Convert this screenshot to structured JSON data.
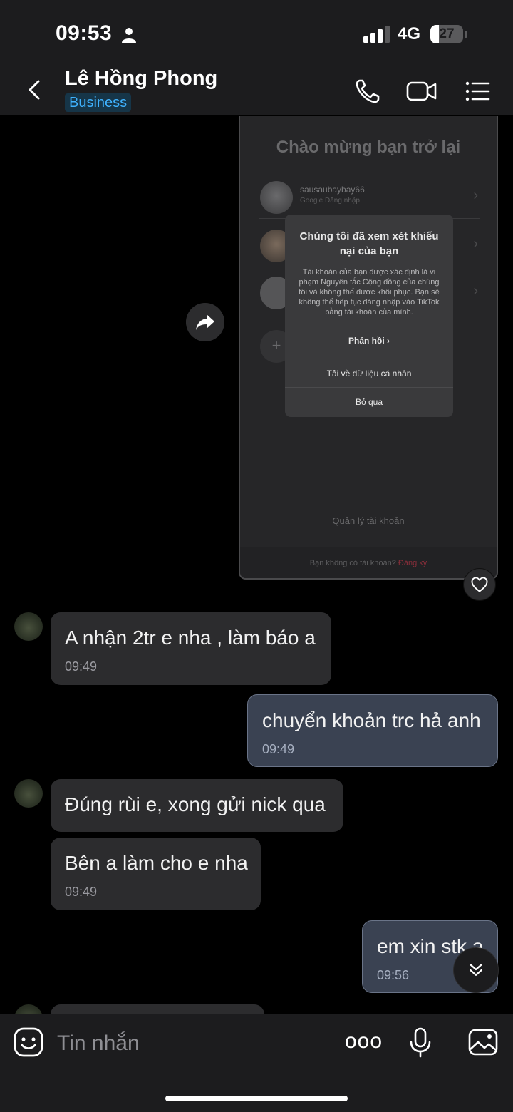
{
  "status_bar": {
    "time": "09:53",
    "network": "4G",
    "battery_level": "27"
  },
  "header": {
    "name": "Lê Hồng Phong",
    "badge": "Business"
  },
  "shared_screenshot": {
    "title": "Chào mừng bạn trở lại",
    "accounts": [
      {
        "name": "sausaubaybay66",
        "sub": "Google Đăng nhập"
      }
    ],
    "dialog": {
      "title": "Chúng tôi đã xem xét khiếu nại của bạn",
      "body": "Tài khoản của bạn được xác định là vi phạm Nguyên tắc Cộng đồng của chúng tôi và không thể được khôi phục. Bạn sẽ không thể tiếp tục đăng nhập vào TikTok bằng tài khoản của mình.",
      "link": "Phản hồi ›",
      "btn_download": "Tải về dữ liệu cá nhân",
      "btn_skip": "Bỏ qua"
    },
    "manage": "Quản lý tài khoản",
    "footer_text": "Bạn không có tài khoản?",
    "footer_link": "Đăng ký",
    "add_label": "+"
  },
  "messages": [
    {
      "text": "A nhận 2tr e nha , làm báo a",
      "time": "09:49"
    },
    {
      "text": "chuyển khoản trc hả anh",
      "time": "09:49"
    },
    {
      "text": "Đúng rùi e, xong gửi nick qua",
      "time": ""
    },
    {
      "text": "Bên a làm cho e nha",
      "time": "09:49"
    },
    {
      "text": "em xin stk a",
      "time": "09:56"
    }
  ],
  "input": {
    "placeholder": "Tin nhắn",
    "more": "ooo"
  },
  "colors": {
    "accent": "#3fb2ff",
    "incoming_bubble": "#2c2c2e",
    "outgoing_bubble": "#3a4252",
    "background": "#000000"
  },
  "icons": [
    "person-icon",
    "signal-icon",
    "back-icon",
    "phone-icon",
    "video-icon",
    "menu-icon",
    "share-icon",
    "heart-icon",
    "chevron-double-down-icon",
    "sticker-icon",
    "mic-icon",
    "image-icon"
  ]
}
